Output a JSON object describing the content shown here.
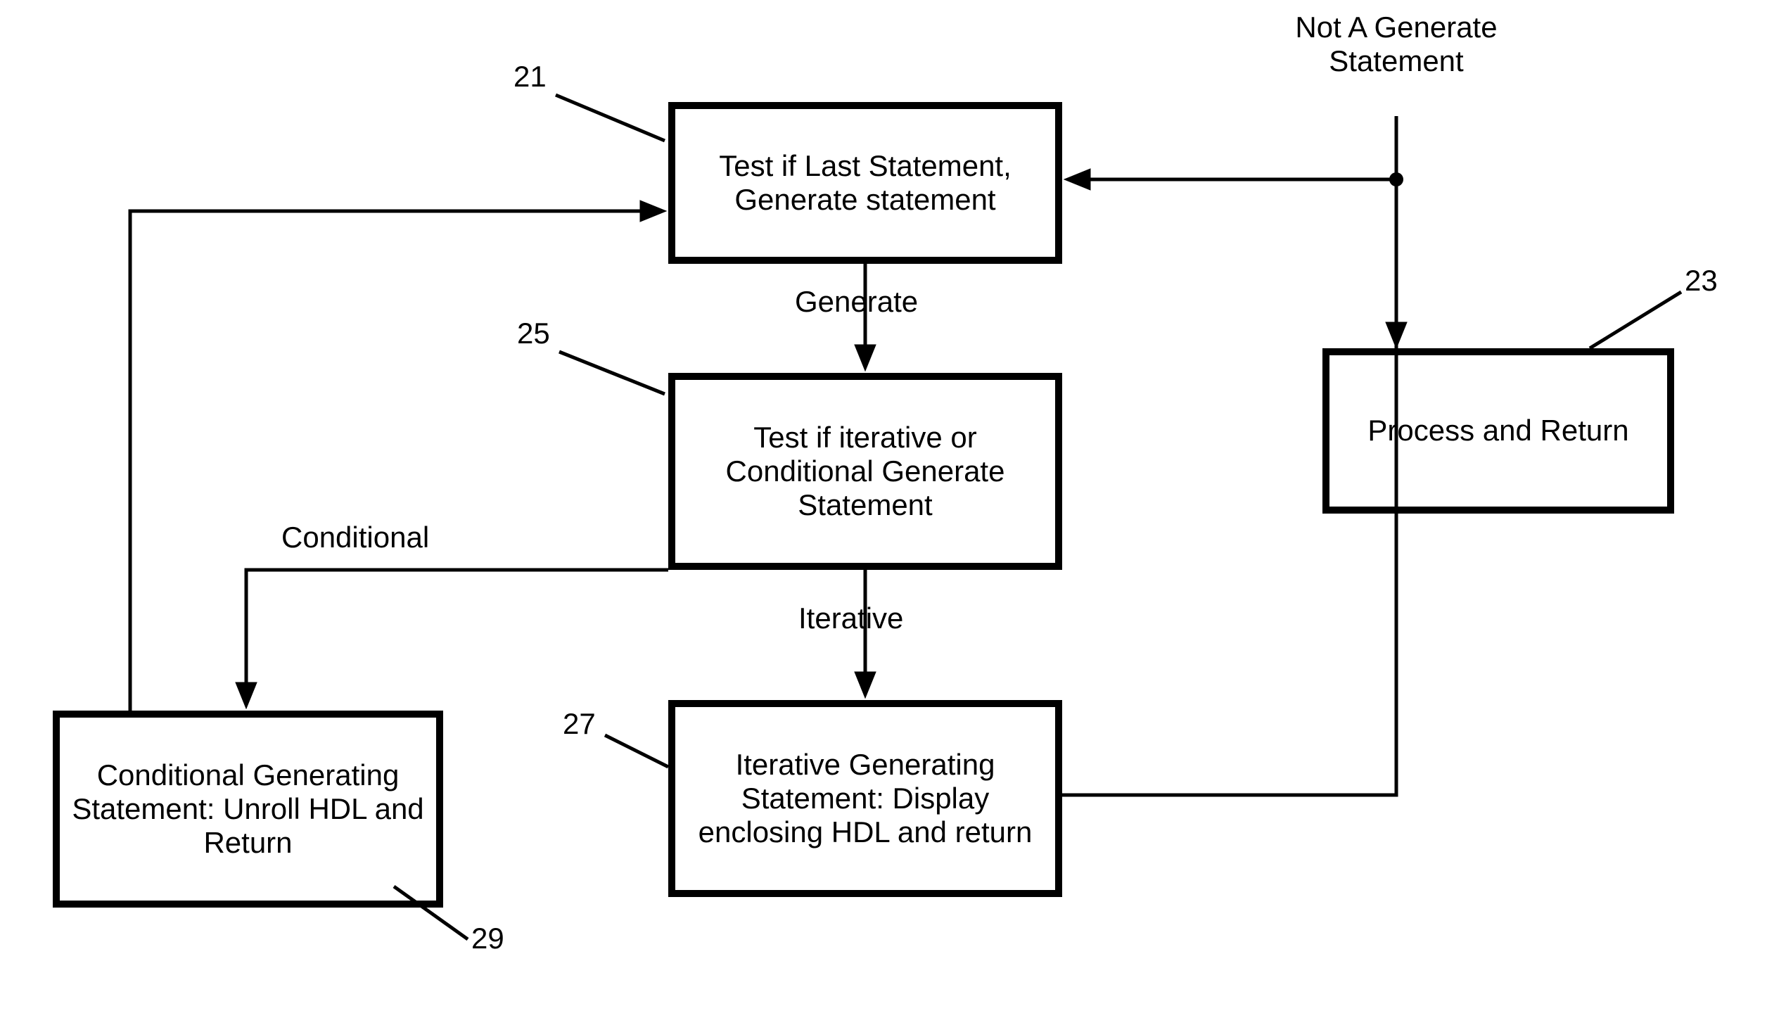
{
  "boxes": {
    "b21": {
      "text": "Test if Last Statement, Generate statement"
    },
    "b23": {
      "text": "Process and Return"
    },
    "b25": {
      "text": "Test if iterative or Conditional Generate Statement"
    },
    "b27": {
      "text": "Iterative Generating Statement: Display enclosing HDL and return"
    },
    "b29": {
      "text": "Conditional Generating Statement: Unroll HDL and Return"
    }
  },
  "labels": {
    "l21": "21",
    "l23": "23",
    "l25": "25",
    "l27": "27",
    "l29": "29",
    "notGenerate": "Not A Generate Statement",
    "generate": "Generate",
    "iterative": "Iterative",
    "conditional": "Conditional"
  }
}
